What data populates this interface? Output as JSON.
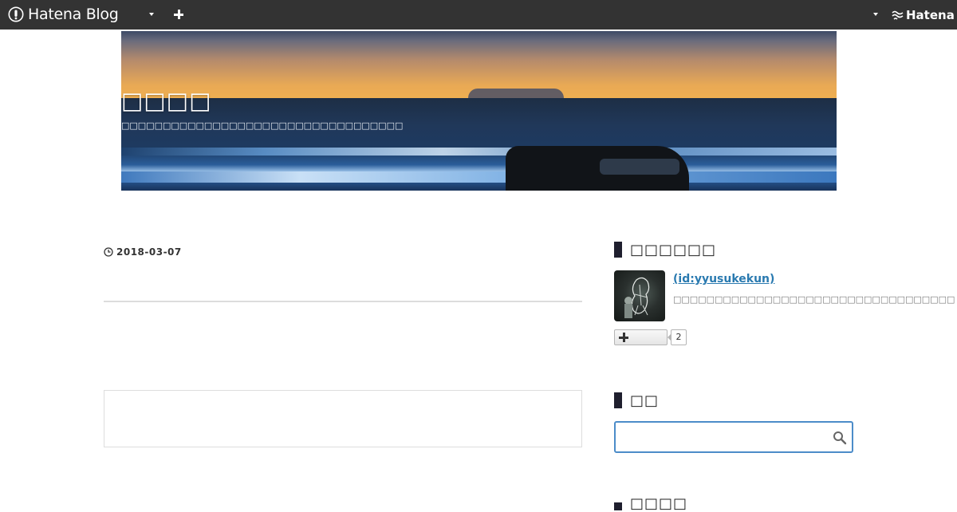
{
  "globalheader": {
    "brand": "Hatena Blog",
    "brand_icon": "hatena-blog-logo-icon",
    "hatena_label": "Hatena",
    "hatena_icon": "hatena-logo-icon",
    "colors": {
      "background": "#333333",
      "text": "#ffffff"
    }
  },
  "blog": {
    "title": "□□□□",
    "description": "□□□□□□□□□□□□□□□□□□□□□□□□□□□□□□□□□□"
  },
  "entry": {
    "date": "2018-03-07",
    "date_icon": "clock-icon"
  },
  "sidebar": {
    "profile": {
      "heading": "□□□□□□",
      "id_label": " (id:yyusukekun)",
      "description": "□□□□□□□□□□□□□□□□□□□□□□□□□□□□□□□□□□",
      "subscribe_count": "2"
    },
    "search": {
      "heading": "□□",
      "placeholder": "",
      "value": ""
    },
    "next_module_heading": "□□□□"
  },
  "colors": {
    "accent_link": "#2a7ab0",
    "search_border": "#4c8cc9",
    "module_bar": "#1f1f2e"
  }
}
